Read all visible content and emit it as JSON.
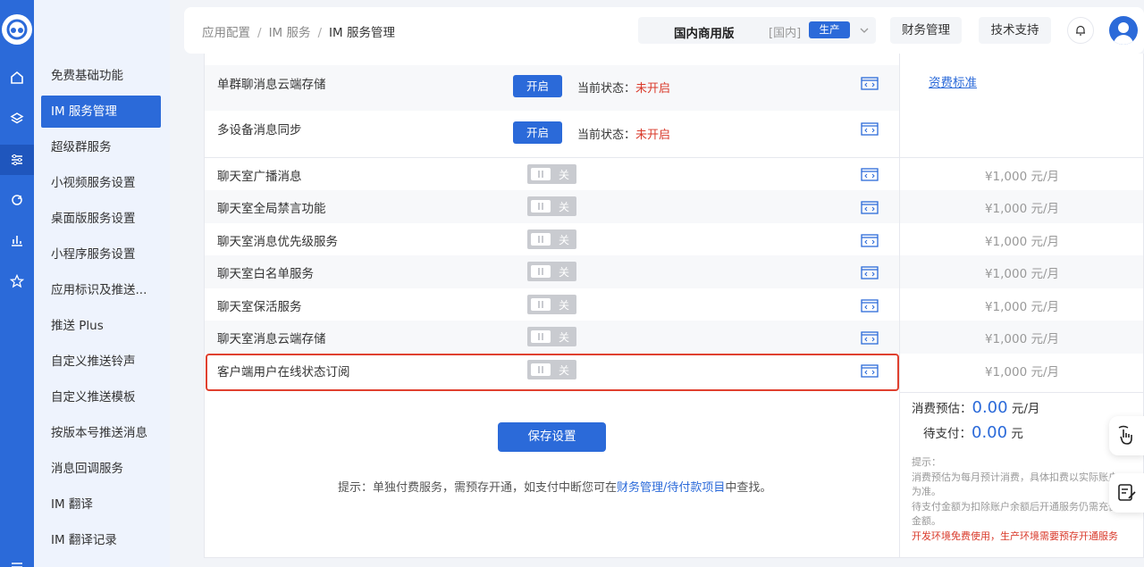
{
  "breadcrumb": [
    "应用配置",
    "IM 服务",
    "IM 服务管理"
  ],
  "header": {
    "edition": "国内商用版",
    "region": "[国内]",
    "env_tag": "生产",
    "finance_btn": "财务管理",
    "support_btn": "技术支持"
  },
  "sidebar": {
    "items": [
      {
        "label": "免费基础功能",
        "active": false
      },
      {
        "label": "IM 服务管理",
        "active": true
      },
      {
        "label": "超级群服务",
        "active": false
      },
      {
        "label": "小视频服务设置",
        "active": false
      },
      {
        "label": "桌面版服务设置",
        "active": false
      },
      {
        "label": "小程序服务设置",
        "active": false
      },
      {
        "label": "应用标识及推送...",
        "active": false
      },
      {
        "label": "推送 Plus",
        "active": false
      },
      {
        "label": "自定义推送铃声",
        "active": false
      },
      {
        "label": "自定义推送模板",
        "active": false
      },
      {
        "label": "按版本号推送消息",
        "active": false
      },
      {
        "label": "消息回调服务",
        "active": false
      },
      {
        "label": "IM 翻译",
        "active": false
      },
      {
        "label": "IM 翻译记录",
        "active": false
      }
    ]
  },
  "free_services": [
    {
      "label": "单群聊消息云端存储",
      "button": "开启",
      "state_label": "当前状态：",
      "state_value": "未开启"
    },
    {
      "label": "多设备消息同步",
      "button": "开启",
      "state_label": "当前状态：",
      "state_value": "未开启"
    }
  ],
  "fee_standard_link": "资费标准",
  "paid_services": [
    {
      "label": "聊天室广播消息",
      "toggle": "关",
      "price": "¥1,000 元/月"
    },
    {
      "label": "聊天室全局禁言功能",
      "toggle": "关",
      "price": "¥1,000 元/月"
    },
    {
      "label": "聊天室消息优先级服务",
      "toggle": "关",
      "price": "¥1,000 元/月"
    },
    {
      "label": "聊天室白名单服务",
      "toggle": "关",
      "price": "¥1,000 元/月"
    },
    {
      "label": "聊天室保活服务",
      "toggle": "关",
      "price": "¥1,000 元/月"
    },
    {
      "label": "聊天室消息云端存储",
      "toggle": "关",
      "price": "¥1,000 元/月"
    },
    {
      "label": "客户端用户在线状态订阅",
      "toggle": "关",
      "price": "¥1,000 元/月"
    }
  ],
  "save_button": "保存设置",
  "tip": {
    "prefix": "提示：单独付费服务，需预存开通，如支付中断您可在",
    "link": "财务管理/待付款项目",
    "suffix": "中查找。"
  },
  "estimate": {
    "monthly_label": "消费预估：",
    "monthly_value": "0.00",
    "monthly_unit": "元/月",
    "pending_label": "待支付：",
    "pending_value": "0.00",
    "pending_unit": "元"
  },
  "note": {
    "title": "提示：",
    "line1": "消费预估为每月预计消费，具体扣费以实际账户为准。",
    "line2": "待支付金额为扣除账户余额后开通服务仍需充值金额。",
    "warning": "开发环境免费使用，生产环境需要预存开通服务"
  },
  "colors": {
    "primary": "#2b6ad9",
    "danger": "#d93a2b",
    "toggle_off": "#c9cbd0"
  }
}
